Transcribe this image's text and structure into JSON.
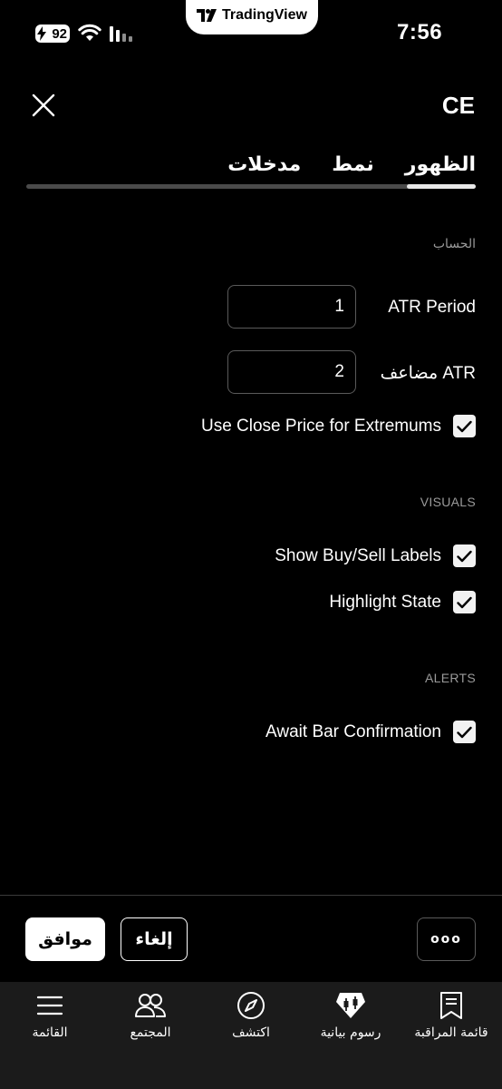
{
  "status_bar": {
    "time": "7:56",
    "battery": "92",
    "app_badge": "TradingView"
  },
  "header": {
    "title": "CE"
  },
  "tabs": [
    {
      "label": "مدخلات",
      "active": true
    },
    {
      "label": "نمط",
      "active": false
    },
    {
      "label": "الظهور",
      "active": false
    }
  ],
  "sections": {
    "calculation": {
      "label": "الحساب",
      "atr_period": {
        "label": "ATR Period",
        "value": "1"
      },
      "atr_multiplier": {
        "label": "مضاعف ATR",
        "value": "2"
      },
      "use_close": {
        "label": "Use Close Price for Extremums",
        "checked": true
      }
    },
    "visuals": {
      "label": "VISUALS",
      "show_labels": {
        "label": "Show Buy/Sell Labels",
        "checked": true
      },
      "highlight_state": {
        "label": "Highlight State",
        "checked": true
      }
    },
    "alerts": {
      "label": "ALERTS",
      "await_bar": {
        "label": "Await Bar Confirmation",
        "checked": true
      }
    }
  },
  "actions": {
    "ok_label": "موافق",
    "cancel_label": "إلغاء",
    "more_label": "ooo"
  },
  "bottom_nav": [
    {
      "label": "قائمة المراقبة",
      "icon": "bookmark-icon"
    },
    {
      "label": "رسوم بيانية",
      "icon": "candles-icon"
    },
    {
      "label": "اكتشف",
      "icon": "compass-icon"
    },
    {
      "label": "المجتمع",
      "icon": "people-icon"
    },
    {
      "label": "القائمة",
      "icon": "menu-icon"
    }
  ]
}
